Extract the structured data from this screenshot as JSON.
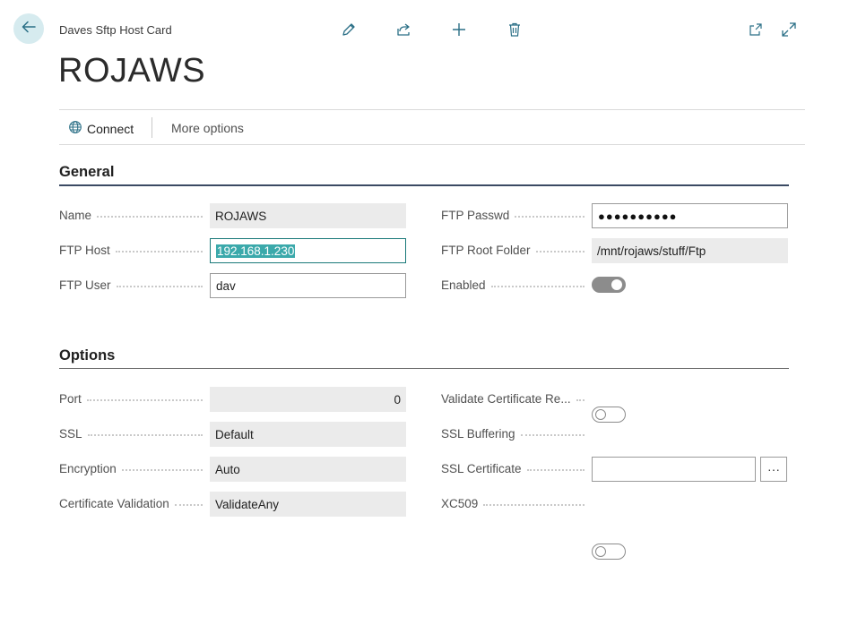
{
  "header": {
    "caption": "Daves Sftp Host Card",
    "title": "ROJAWS",
    "icons": [
      "back-arrow-icon",
      "edit-pencil-icon",
      "share-icon",
      "new-plus-icon",
      "delete-trash-icon",
      "open-new-window-icon",
      "expand-icon"
    ]
  },
  "actions": {
    "connect_label": "Connect",
    "more_label": "More options"
  },
  "general": {
    "title": "General",
    "name_label": "Name",
    "name_value": "ROJAWS",
    "host_label": "FTP Host",
    "host_value": "192.168.1.230",
    "user_label": "FTP User",
    "user_value": "dav",
    "passwd_label": "FTP Passwd",
    "passwd_value": "●●●●●●●●●●",
    "root_label": "FTP Root Folder",
    "root_value": "/mnt/rojaws/stuff/Ftp",
    "enabled_label": "Enabled",
    "enabled_value": true
  },
  "options": {
    "title": "Options",
    "port_label": "Port",
    "port_value": "0",
    "ssl_label": "SSL",
    "ssl_value": "Default",
    "encryption_label": "Encryption",
    "encryption_value": "Auto",
    "certval_label": "Certificate Validation",
    "certval_value": "ValidateAny",
    "validate_label": "Validate Certificate Re...",
    "validate_value": false,
    "buffering_label": "SSL Buffering",
    "buffering_value": true,
    "sslcert_label": "SSL Certificate",
    "sslcert_value": "",
    "sslcert_lookup": "···",
    "xc509_label": "XC509",
    "xc509_value": false
  },
  "colors": {
    "accent": "#3ba9ab",
    "back_button_bg": "#d6ebef",
    "section_rule": "#1f2f4a"
  }
}
